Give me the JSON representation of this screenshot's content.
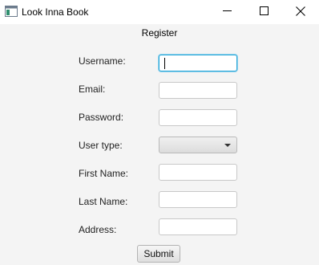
{
  "window": {
    "title": "Look Inna Book",
    "icon": "app-window-icon",
    "controls": [
      "minimize-icon",
      "maximize-icon",
      "close-icon"
    ]
  },
  "form": {
    "heading": "Register",
    "fields": [
      {
        "label": "Username:",
        "value": "",
        "focused": true
      },
      {
        "label": "Email:",
        "value": ""
      },
      {
        "label": "Password:",
        "value": ""
      },
      {
        "label": "User type:",
        "value": "",
        "type": "select"
      },
      {
        "label": "First Name:",
        "value": ""
      },
      {
        "label": "Last Name:",
        "value": ""
      },
      {
        "label": "Address:",
        "value": ""
      }
    ],
    "submit_label": "Submit"
  },
  "colors": {
    "focus_border": "#2aa7d8",
    "background": "#f4f4f4"
  }
}
